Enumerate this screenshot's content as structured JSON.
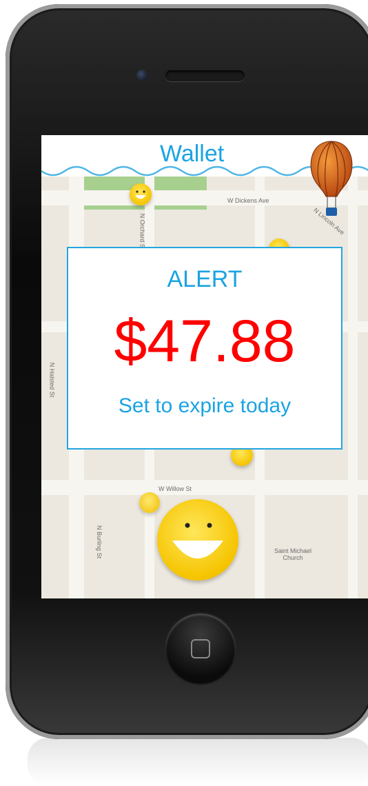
{
  "header": {
    "title": "Wallet"
  },
  "alert": {
    "title": "ALERT",
    "amount": "$47.88",
    "subtitle": "Set to expire today"
  },
  "map": {
    "streets": [
      "W Dickens Ave",
      "N Lincoln Ave",
      "N Halsted St",
      "N Burling St",
      "N Orchard St",
      "W Willow St",
      "Saint Michael Church"
    ]
  },
  "icons": [
    "hot-air-balloon-icon",
    "smiley-icon",
    "home-button-icon"
  ],
  "colors": {
    "accent": "#1aa3e2",
    "amount": "#ff0000",
    "smiley": "#f5c400"
  }
}
